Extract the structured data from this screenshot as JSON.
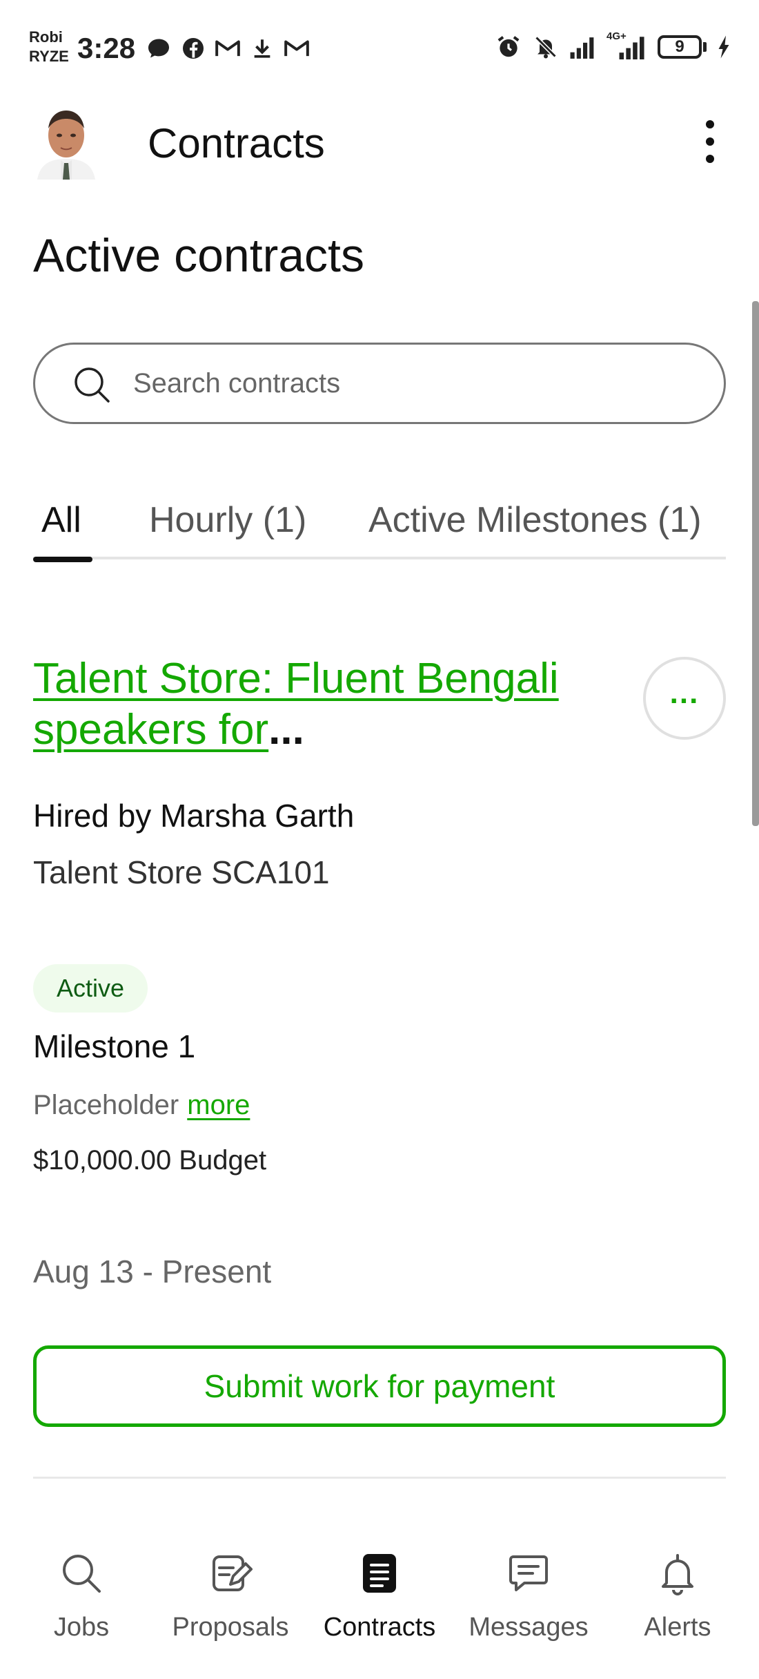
{
  "status_bar": {
    "carrier_line1": "Robi",
    "carrier_line2": "RYZE",
    "time": "3:28",
    "battery": "9",
    "network": "4G+",
    "left_icons": [
      "chat-bubble-icon",
      "facebook-icon",
      "gmail-icon",
      "download-icon",
      "gmail-icon"
    ],
    "right_icons": [
      "alarm-icon",
      "bell-off-icon",
      "signal-icon",
      "signal-4g-icon",
      "battery-icon",
      "charging-icon"
    ]
  },
  "header": {
    "title": "Contracts",
    "menu_icon": "kebab-menu-icon"
  },
  "page": {
    "title": "Active contracts"
  },
  "search": {
    "placeholder": "Search contracts",
    "value": ""
  },
  "tabs": [
    {
      "label": "All",
      "active": true
    },
    {
      "label": "Hourly (1)",
      "active": false
    },
    {
      "label": "Active Milestones (1)",
      "active": false
    }
  ],
  "contract": {
    "title_line1": "Talent Store: Fluent Bengali",
    "title_line2": "speakers for",
    "title_ellipsis": "...",
    "more_actions": "...",
    "hired_by": "Hired by Marsha Garth",
    "company": "Talent Store SCA101",
    "status": "Active",
    "milestone_name": "Milestone 1",
    "milestone_desc": "Placeholder",
    "more_link": "more",
    "budget": "$10,000.00 Budget",
    "date_range": "Aug 13 - Present",
    "submit_label": "Submit work for payment"
  },
  "colors": {
    "accent": "#14a800",
    "badge_bg": "#effbec",
    "badge_text": "#0f5c14"
  },
  "bottom_nav": [
    {
      "label": "Jobs",
      "icon": "search-icon",
      "active": false
    },
    {
      "label": "Proposals",
      "icon": "edit-document-icon",
      "active": false
    },
    {
      "label": "Contracts",
      "icon": "contract-document-icon",
      "active": true
    },
    {
      "label": "Messages",
      "icon": "message-icon",
      "active": false
    },
    {
      "label": "Alerts",
      "icon": "bell-icon",
      "active": false
    }
  ]
}
